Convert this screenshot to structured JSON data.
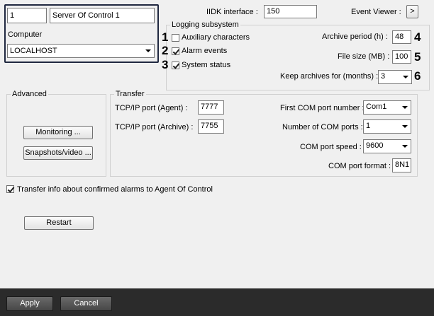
{
  "object": {
    "id": "1",
    "name": "Server Of Control 1"
  },
  "computer": {
    "label": "Computer",
    "value": "LOCALHOST"
  },
  "iidk": {
    "label": "IIDK interface :",
    "value": "150"
  },
  "event_viewer": {
    "label": "Event Viewer :",
    "button": ">"
  },
  "logging": {
    "title": "Logging subsystem",
    "items": [
      {
        "marker": "1",
        "label": "Auxiliary characters",
        "checked": false
      },
      {
        "marker": "2",
        "label": "Alarm events",
        "checked": true
      },
      {
        "marker": "3",
        "label": "System status",
        "checked": true
      }
    ],
    "archive_period": {
      "label": "Archive period (h) :",
      "value": "48",
      "marker": "4"
    },
    "file_size": {
      "label": "File size (MB) :",
      "value": "100",
      "marker": "5"
    },
    "keep_archives": {
      "label": "Keep archives for (months) :",
      "value": "3",
      "marker": "6"
    }
  },
  "advanced": {
    "title": "Advanced",
    "monitoring_button": "Monitoring ...",
    "snapshots_button": "Snapshots/video ..."
  },
  "transfer": {
    "title": "Transfer",
    "agent_port": {
      "label": "TCP/IP port (Agent) :",
      "value": "7777"
    },
    "archive_port": {
      "label": "TCP/IP port (Archive) :",
      "value": "7755"
    },
    "first_com": {
      "label": "First COM port number :",
      "value": "Com1"
    },
    "num_com": {
      "label": "Number of COM ports :",
      "value": "1"
    },
    "com_speed": {
      "label": "COM port speed :",
      "value": "9600"
    },
    "com_format": {
      "label": "COM port format :",
      "value": "8N1"
    }
  },
  "transfer_info": {
    "label": "Transfer info about confirmed alarms to Agent Of Control",
    "checked": true
  },
  "restart_button": "Restart",
  "footer": {
    "apply": "Apply",
    "cancel": "Cancel"
  }
}
